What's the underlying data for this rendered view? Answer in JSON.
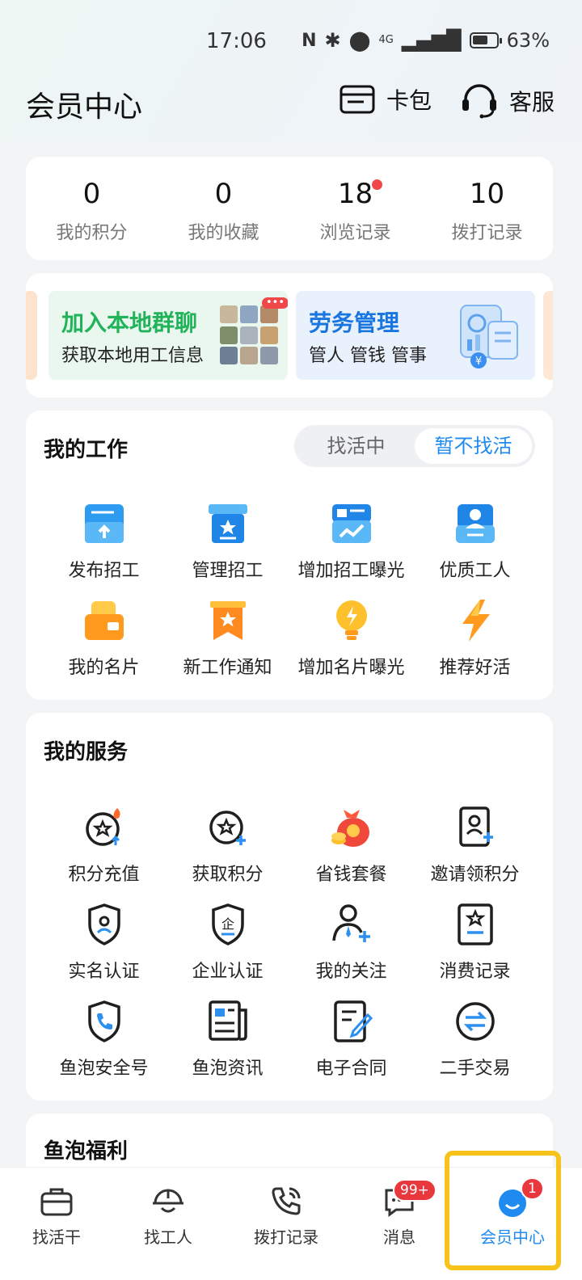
{
  "status_bar": {
    "time": "17:06",
    "network": "4G",
    "battery": "63%"
  },
  "header": {
    "title": "会员中心",
    "wallet_label": "卡包",
    "service_label": "客服"
  },
  "stats": [
    {
      "value": "0",
      "label": "我的积分",
      "dot": false
    },
    {
      "value": "0",
      "label": "我的收藏",
      "dot": false
    },
    {
      "value": "18",
      "label": "浏览记录",
      "dot": true
    },
    {
      "value": "10",
      "label": "拨打记录",
      "dot": false
    }
  ],
  "banners": {
    "group_chat": {
      "title": "加入本地群聊",
      "subtitle": "获取本地用工信息",
      "badge": "•••"
    },
    "labor": {
      "title": "劳务管理",
      "subtitle": "管人 管钱 管事"
    }
  },
  "my_work": {
    "title": "我的工作",
    "toggle": [
      "找活中",
      "暂不找活"
    ],
    "toggle_active": "暂不找活",
    "items": [
      {
        "label": "发布招工",
        "icon": "post-job-icon"
      },
      {
        "label": "管理招工",
        "icon": "manage-jobs-icon"
      },
      {
        "label": "增加招工曝光",
        "icon": "job-exposure-icon"
      },
      {
        "label": "优质工人",
        "icon": "quality-worker-icon"
      },
      {
        "label": "我的名片",
        "icon": "business-card-icon"
      },
      {
        "label": "新工作通知",
        "icon": "job-notice-icon"
      },
      {
        "label": "增加名片曝光",
        "icon": "lightbulb-icon"
      },
      {
        "label": "推荐好活",
        "icon": "lightning-icon"
      }
    ]
  },
  "my_services": {
    "title": "我的服务",
    "items": [
      {
        "label": "积分充值",
        "icon": "points-recharge-icon"
      },
      {
        "label": "获取积分",
        "icon": "get-points-icon"
      },
      {
        "label": "省钱套餐",
        "icon": "money-bag-icon"
      },
      {
        "label": "邀请领积分",
        "icon": "invite-points-icon"
      },
      {
        "label": "实名认证",
        "icon": "id-verify-icon"
      },
      {
        "label": "企业认证",
        "icon": "enterprise-verify-icon"
      },
      {
        "label": "我的关注",
        "icon": "follow-icon"
      },
      {
        "label": "消费记录",
        "icon": "consume-record-icon"
      },
      {
        "label": "鱼泡安全号",
        "icon": "safe-phone-icon"
      },
      {
        "label": "鱼泡资讯",
        "icon": "news-icon"
      },
      {
        "label": "电子合同",
        "icon": "contract-icon"
      },
      {
        "label": "二手交易",
        "icon": "exchange-icon"
      }
    ]
  },
  "welfare": {
    "title": "鱼泡福利"
  },
  "bottom_nav": [
    {
      "label": "找活干",
      "icon": "briefcase-icon",
      "badge": ""
    },
    {
      "label": "找工人",
      "icon": "helmet-icon",
      "badge": ""
    },
    {
      "label": "拨打记录",
      "icon": "phone-call-icon",
      "badge": ""
    },
    {
      "label": "消息",
      "icon": "message-icon",
      "badge": "99+"
    },
    {
      "label": "会员中心",
      "icon": "member-icon",
      "badge": "1"
    }
  ],
  "colors": {
    "accent": "#1f8af0",
    "badge": "#e8383d",
    "highlight": "#f7c21a",
    "green": "#21b35a"
  }
}
